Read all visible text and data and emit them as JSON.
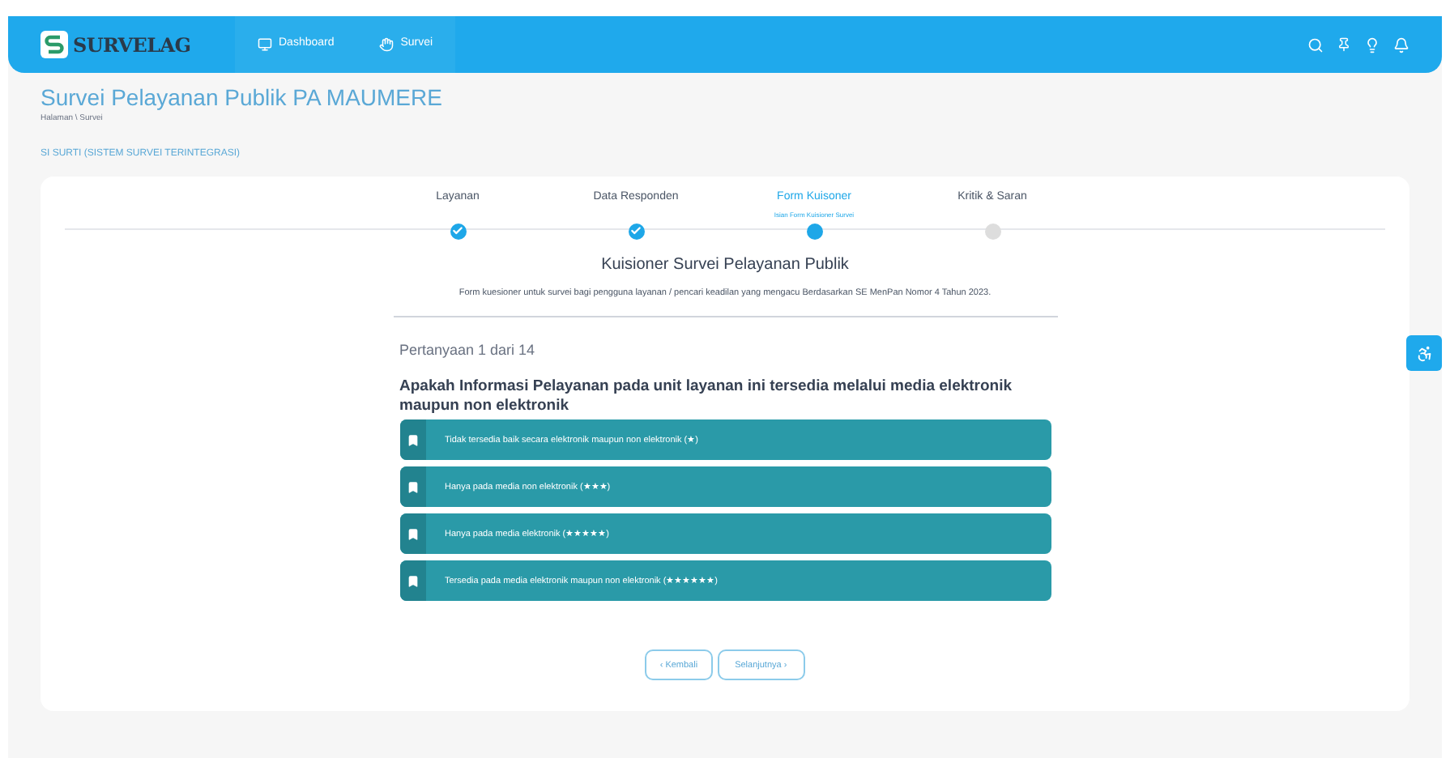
{
  "header": {
    "logo": "SURVELAG",
    "nav": [
      {
        "label": "Dashboard"
      },
      {
        "label": "Survei"
      }
    ]
  },
  "page": {
    "title": "Survei Pelayanan Publik PA MAUMERE",
    "breadcrumb": "Halaman \\ Survei",
    "section": "SI SURTI (SISTEM SURVEI TERINTEGRASI)"
  },
  "steps": [
    {
      "label": "Layanan",
      "completed": true,
      "selected": false
    },
    {
      "label": "Data Responden",
      "completed": true,
      "selected": false
    },
    {
      "label": "Form Kuisoner",
      "subtitle": "Isian Form Kuisioner Survei",
      "completed": false,
      "selected": true
    },
    {
      "label": "Kritik & Saran",
      "completed": false,
      "selected": false
    }
  ],
  "form": {
    "title": "Kuisioner Survei Pelayanan Publik",
    "description": "Form kuesioner untuk survei bagi pengguna layanan / pencari keadilan yang mengacu Berdasarkan SE MenPan Nomor 4 Tahun 2023.",
    "progress": "Pertanyaan 1 dari 14",
    "question": "Apakah Informasi Pelayanan pada unit layanan ini tersedia melalui media elektronik maupun non elektronik",
    "options": [
      {
        "text": "Tidak tersedia baik secara elektronik maupun non elektronik (★)",
        "selected": false
      },
      {
        "text": "Hanya pada media non elektronik (★★★)",
        "selected": false
      },
      {
        "text": "Hanya pada media elektronik (★★★★★)",
        "selected": false
      },
      {
        "text": "Tersedia pada media elektronik maupun non elektronik (★★★★★★)",
        "selected": false
      }
    ],
    "back": "‹ Kembali",
    "next": "Selanjutnya ›"
  }
}
